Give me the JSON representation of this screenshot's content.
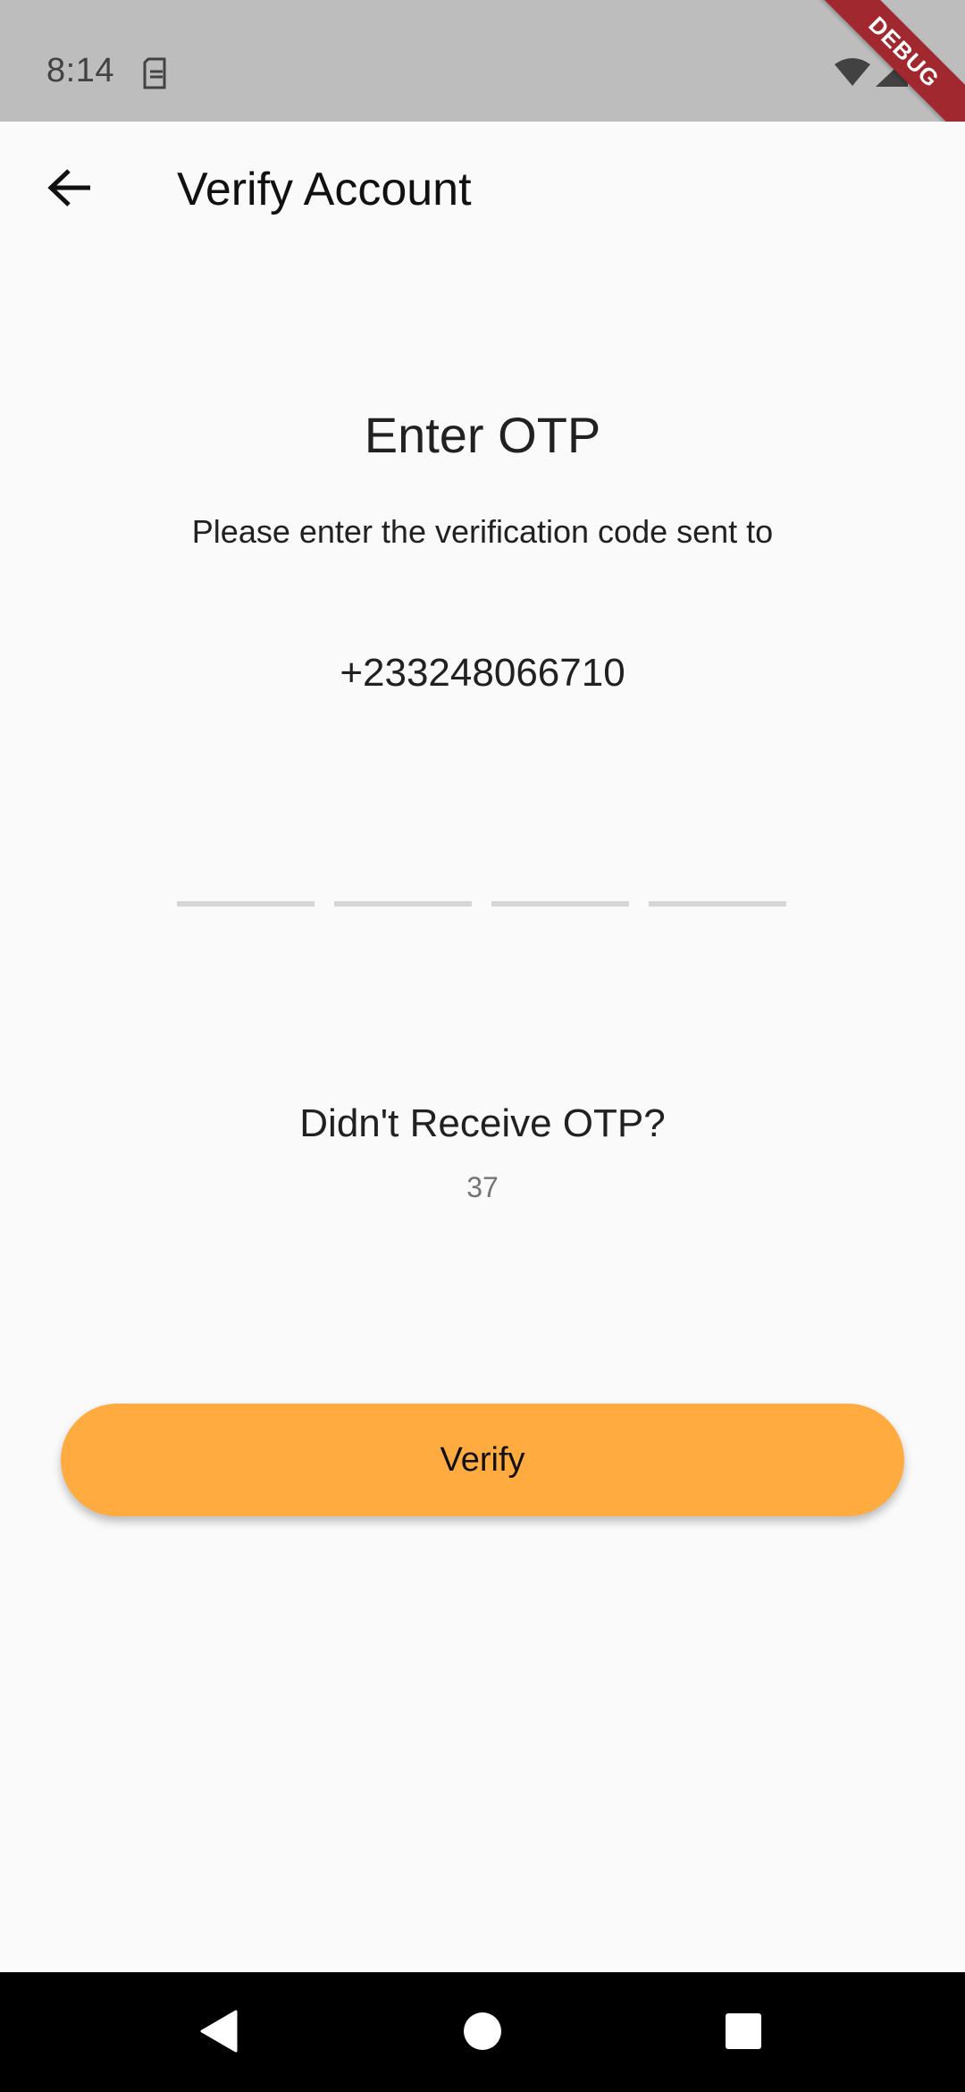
{
  "status_bar": {
    "time": "8:14",
    "debug_label": "DEBUG"
  },
  "app_bar": {
    "title": "Verify Account"
  },
  "main": {
    "heading": "Enter OTP",
    "subtitle": "Please enter the verification code sent to",
    "phone_number": "+233248066710",
    "otp_digits": [
      "",
      "",
      "",
      ""
    ],
    "resend_prompt": "Didn't Receive OTP?",
    "countdown": "37",
    "verify_label": "Verify"
  },
  "colors": {
    "accent": "#ffab40",
    "status_bar_bg": "#bdbdbd",
    "background": "#fafafa",
    "otp_underline": "#d6d6d6",
    "debug_ribbon": "#a0282e"
  },
  "icons": {
    "back": "arrow-left-icon",
    "sim": "sim-card-icon",
    "wifi": "wifi-icon",
    "signal": "signal-icon",
    "battery": "battery-icon",
    "nav_back": "triangle-back-icon",
    "nav_home": "circle-home-icon",
    "nav_recents": "square-recents-icon"
  }
}
